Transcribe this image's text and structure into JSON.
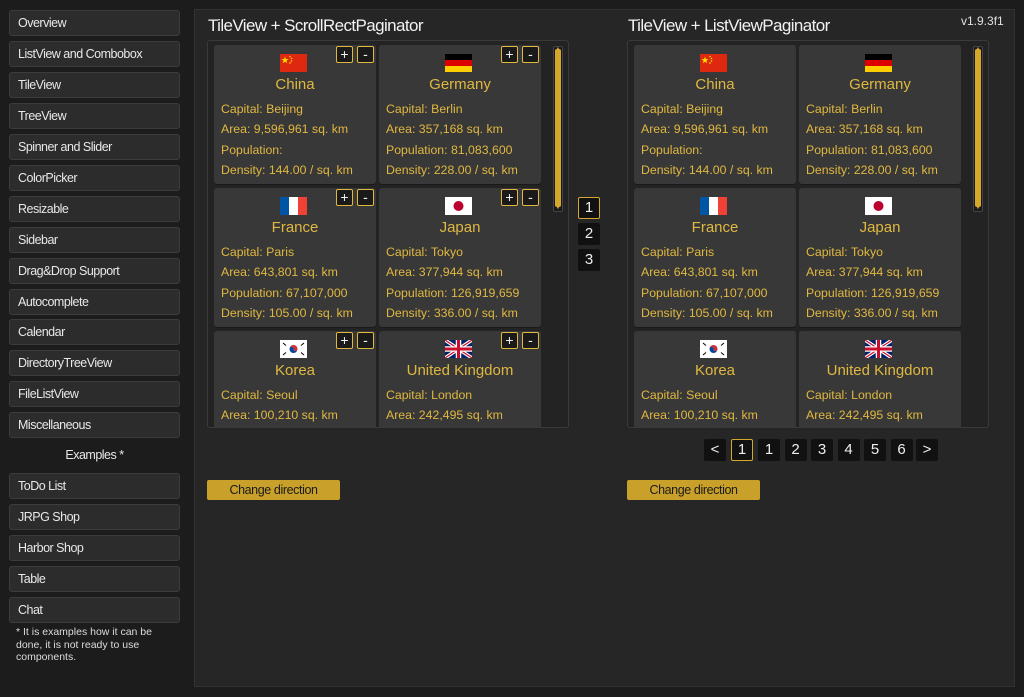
{
  "version": "v1.9.3f1",
  "sidebar": {
    "items": [
      {
        "label": "Overview"
      },
      {
        "label": "ListView and Combobox"
      },
      {
        "label": "TileView"
      },
      {
        "label": "TreeView"
      },
      {
        "label": "Spinner and Slider"
      },
      {
        "label": "ColorPicker"
      },
      {
        "label": "Resizable"
      },
      {
        "label": "Sidebar"
      },
      {
        "label": "Drag&Drop Support"
      },
      {
        "label": "Autocomplete"
      },
      {
        "label": "Calendar"
      },
      {
        "label": "DirectoryTreeView"
      },
      {
        "label": "FileListView"
      },
      {
        "label": "Miscellaneous"
      }
    ],
    "section_label": "Examples *",
    "examples": [
      {
        "label": "ToDo List"
      },
      {
        "label": "JRPG Shop"
      },
      {
        "label": "Harbor Shop"
      },
      {
        "label": "Table"
      },
      {
        "label": "Chat"
      }
    ],
    "note": "* It is examples how it can be done, it is not ready to use components."
  },
  "panels": [
    {
      "title": "TileView + ScrollRectPaginator",
      "change_label": "Change direction",
      "pages": [
        "1",
        "2",
        "3"
      ],
      "active_page": "1"
    },
    {
      "title": "TileView + ListViewPaginator",
      "change_label": "Change direction",
      "prev": "<",
      "next": ">",
      "current": "1",
      "pages": [
        "1",
        "2",
        "3",
        "4",
        "5",
        "6"
      ]
    }
  ],
  "tile_buttons": {
    "plus": "+",
    "minus": "-"
  },
  "countries": [
    {
      "name": "China",
      "flag": "china-flag",
      "capital": "Capital: Beijing",
      "area": "Area: 9,596,961 sq. km",
      "population": "Population:",
      "density": "Density: 144.00 / sq. km"
    },
    {
      "name": "Germany",
      "flag": "germany-flag",
      "capital": "Capital: Berlin",
      "area": "Area: 357,168 sq. km",
      "population": "Population: 81,083,600",
      "density": "Density: 228.00 / sq. km"
    },
    {
      "name": "France",
      "flag": "france-flag",
      "capital": "Capital: Paris",
      "area": "Area: 643,801 sq. km",
      "population": "Population: 67,107,000",
      "density": "Density: 105.00 / sq. km"
    },
    {
      "name": "Japan",
      "flag": "japan-flag",
      "capital": "Capital: Tokyo",
      "area": "Area: 377,944 sq. km",
      "population": "Population: 126,919,659",
      "density": "Density: 336.00 / sq. km"
    },
    {
      "name": "Korea",
      "flag": "korea-flag",
      "capital": "Capital: Seoul",
      "area": "Area: 100,210 sq. km",
      "population": "",
      "density": ""
    },
    {
      "name": "United Kingdom",
      "flag": "uk-flag",
      "capital": "Capital: London",
      "area": "Area: 242,495 sq. km",
      "population": "",
      "density": ""
    }
  ],
  "colors": {
    "accent": "#e0b840",
    "button": "#c9a12a",
    "background": "#1c1c1c",
    "tile": "#383838"
  }
}
